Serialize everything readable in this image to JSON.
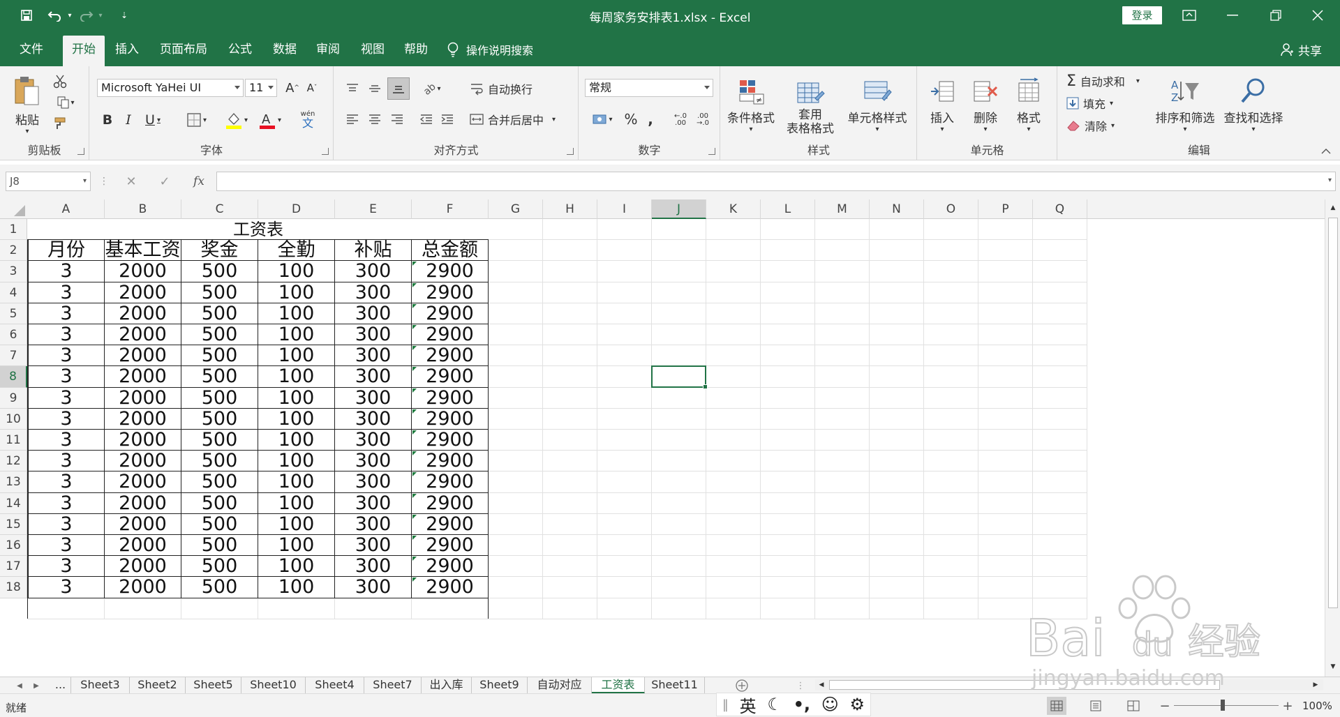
{
  "titlebar": {
    "doc_title": "每周家务安排表1.xlsx  -  Excel",
    "login_label": "登录"
  },
  "menu_tabs": [
    "文件",
    "开始",
    "插入",
    "页面布局",
    "公式",
    "数据",
    "审阅",
    "视图",
    "帮助"
  ],
  "active_tab": "开始",
  "search_label": "操作说明搜索",
  "share_label": "共享",
  "ribbon": {
    "clipboard": {
      "label": "剪贴板",
      "paste": "粘贴"
    },
    "font": {
      "label": "字体",
      "name": "Microsoft YaHei UI",
      "size": "11",
      "phonetic_top": "wén",
      "phonetic_bottom": "文"
    },
    "alignment": {
      "label": "对齐方式",
      "wrap_text": "自动换行",
      "merge_center": "合并后居中"
    },
    "number": {
      "label": "数字",
      "format": "常规"
    },
    "styles": {
      "label": "样式",
      "conditional": "条件格式",
      "table_format_1": "套用",
      "table_format_2": "表格格式",
      "cell_styles": "单元格样式"
    },
    "cells": {
      "label": "单元格",
      "insert": "插入",
      "delete": "删除",
      "format": "格式"
    },
    "editing": {
      "label": "编辑",
      "autosum": "自动求和",
      "fill": "填充",
      "clear": "清除",
      "sort_filter": "排序和筛选",
      "find_select": "查找和选择"
    }
  },
  "formula_bar": {
    "name_box": "J8",
    "value": ""
  },
  "columns": [
    "A",
    "B",
    "C",
    "D",
    "E",
    "F",
    "G",
    "H",
    "I",
    "J",
    "K",
    "L",
    "M",
    "N",
    "O",
    "P",
    "Q"
  ],
  "selected_column": "J",
  "rows": [
    "1",
    "2",
    "3",
    "4",
    "5",
    "6",
    "7",
    "8",
    "9",
    "10",
    "11",
    "12",
    "13",
    "14",
    "15",
    "16",
    "17",
    "18"
  ],
  "selected_row": "8",
  "selected_cell": "J8",
  "table": {
    "title": "工资表",
    "headers": [
      "月份",
      "基本工资",
      "奖金",
      "全勤",
      "补贴",
      "总金额"
    ],
    "data_rows": [
      [
        "3",
        "2000",
        "500",
        "100",
        "300",
        "2900"
      ],
      [
        "3",
        "2000",
        "500",
        "100",
        "300",
        "2900"
      ],
      [
        "3",
        "2000",
        "500",
        "100",
        "300",
        "2900"
      ],
      [
        "3",
        "2000",
        "500",
        "100",
        "300",
        "2900"
      ],
      [
        "3",
        "2000",
        "500",
        "100",
        "300",
        "2900"
      ],
      [
        "3",
        "2000",
        "500",
        "100",
        "300",
        "2900"
      ],
      [
        "3",
        "2000",
        "500",
        "100",
        "300",
        "2900"
      ],
      [
        "3",
        "2000",
        "500",
        "100",
        "300",
        "2900"
      ],
      [
        "3",
        "2000",
        "500",
        "100",
        "300",
        "2900"
      ],
      [
        "3",
        "2000",
        "500",
        "100",
        "300",
        "2900"
      ],
      [
        "3",
        "2000",
        "500",
        "100",
        "300",
        "2900"
      ],
      [
        "3",
        "2000",
        "500",
        "100",
        "300",
        "2900"
      ],
      [
        "3",
        "2000",
        "500",
        "100",
        "300",
        "2900"
      ],
      [
        "3",
        "2000",
        "500",
        "100",
        "300",
        "2900"
      ],
      [
        "3",
        "2000",
        "500",
        "100",
        "300",
        "2900"
      ],
      [
        "3",
        "2000",
        "500",
        "100",
        "300",
        "2900"
      ]
    ]
  },
  "sheet_tabs": [
    "...",
    "Sheet3",
    "Sheet2",
    "Sheet5",
    "Sheet10",
    "Sheet4",
    "Sheet7",
    "出入库",
    "Sheet9",
    "自动对应",
    "工资表",
    "Sheet11"
  ],
  "active_sheet": "工资表",
  "status": {
    "ready": "就绪",
    "ime_lang": "英",
    "zoom": "100%"
  },
  "watermark": {
    "brand": "Bai",
    "brand2": "du",
    "brand_cn": "经验",
    "url": "jingyan.baidu.com"
  },
  "colors": {
    "accent": "#217346",
    "table_border": "#222222",
    "gridline": "#e1e1e1"
  }
}
